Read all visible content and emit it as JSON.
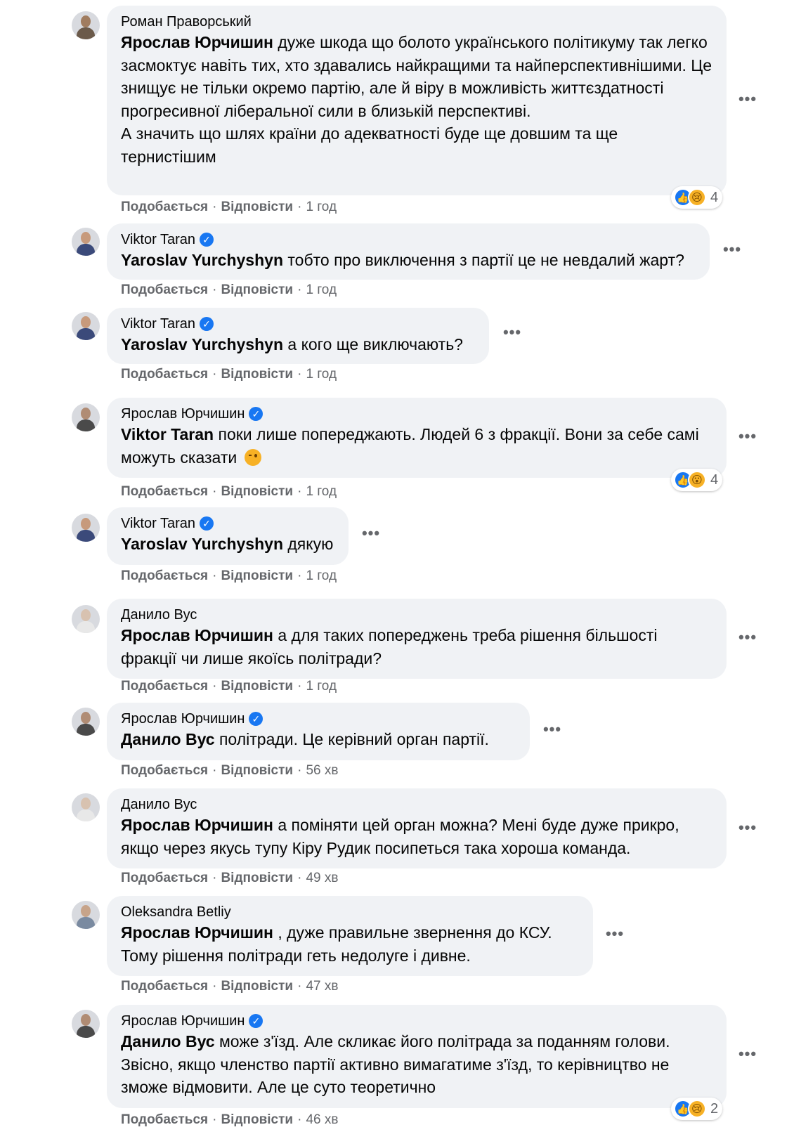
{
  "labels": {
    "like": "Подобається",
    "reply": "Відповісти",
    "separator": "·",
    "more": "•••"
  },
  "colors": {
    "bubble": "#f0f2f5",
    "meta": "#65676b",
    "verified": "#1877f2"
  },
  "comments": [
    {
      "author": "Роман Праворський",
      "verified": false,
      "mention": "Ярослав Юрчишин",
      "text": " дуже шкода що болото українського політикуму так легко засмоктує навіть тих, хто здавались найкращими та найперспективнішими. Це знищує не тільки окремо партію, але й віру в можливість життєздатності прогресивної ліберальної сили в близькій перспективі.\nА значить що шлях країни до адекватності буде ще довшим та ще тернистішим",
      "time": "1 год",
      "reactions": {
        "icons": [
          "like-icon",
          "sad-icon"
        ],
        "count": "4"
      }
    },
    {
      "author": "Viktor Taran",
      "verified": true,
      "mention": "Yaroslav Yurchyshyn",
      "text": " тобто про виключення з партії це не невдалий жарт?",
      "time": "1 год"
    },
    {
      "author": "Viktor Taran",
      "verified": true,
      "mention": "Yaroslav Yurchyshyn",
      "text": " а кого ще виключають?",
      "time": "1 год"
    },
    {
      "author": "Ярослав Юрчишин",
      "verified": true,
      "mention": "Viktor Taran",
      "text": " поки лише попереджають. Людей 6 з фракції. Вони за себе самі можуть сказати ",
      "emoji": "winking-face-emoji",
      "time": "1 год",
      "reactions": {
        "icons": [
          "like-icon",
          "wow-icon"
        ],
        "count": "4"
      }
    },
    {
      "author": "Viktor Taran",
      "verified": true,
      "mention": "Yaroslav Yurchyshyn",
      "text": " дякую",
      "time": "1 год"
    },
    {
      "author": "Данило Вус",
      "verified": false,
      "mention": "Ярослав Юрчишин",
      "text": " а для таких попереджень треба рішення більшості фракції чи лише якоїсь політради?",
      "time": "1 год"
    },
    {
      "author": "Ярослав Юрчишин",
      "verified": true,
      "mention": "Данило Вус",
      "text": " політради. Це керівний орган партії.",
      "time": "56 хв"
    },
    {
      "author": "Данило Вус",
      "verified": false,
      "mention": "Ярослав Юрчишин",
      "text": " а поміняти цей орган можна? Мені буде дуже прикро, якщо через якусь тупу Кіру Рудик посипеться така хороша команда.",
      "time": "49 хв"
    },
    {
      "author": "Oleksandra Betliy",
      "verified": false,
      "mention": "Ярослав Юрчишин",
      "text": " , дуже правильне звернення до КСУ.\nТому рішення політради геть недолуге і дивне.",
      "time": "47 хв"
    },
    {
      "author": "Ярослав Юрчишин",
      "verified": true,
      "mention": "Данило Вус",
      "text": " може з'їзд. Але скликає його політрада за поданням голови. Звісно, якщо членство партії активно вимагатиме з'їзд, то керівництво не зможе відмовити. Але це суто теоретично",
      "time": "46 хв",
      "reactions": {
        "icons": [
          "like-icon",
          "sad-icon"
        ],
        "count": "2"
      }
    }
  ]
}
